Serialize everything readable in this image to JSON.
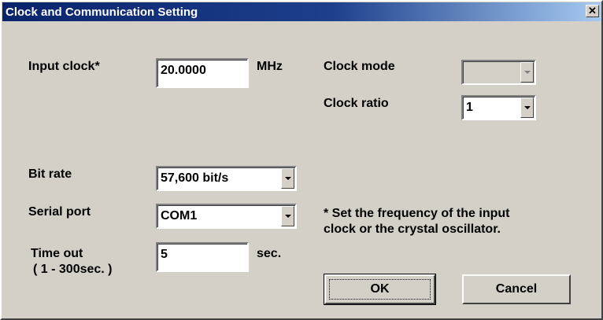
{
  "window": {
    "title": "Clock and Communication Setting",
    "close_label": "✕"
  },
  "input_clock": {
    "label": "Input clock*",
    "value": "20.0000",
    "unit": "MHz"
  },
  "clock_mode": {
    "label": "Clock mode",
    "value": ""
  },
  "clock_ratio": {
    "label": "Clock ratio",
    "value": "1"
  },
  "bit_rate": {
    "label": "Bit rate",
    "value": "57,600 bit/s"
  },
  "serial_port": {
    "label": "Serial port",
    "value": "COM1"
  },
  "time_out": {
    "label": "Time out",
    "range": "( 1 - 300sec. )",
    "value": "5",
    "unit": "sec."
  },
  "note": {
    "line1": "* Set the frequency of the input",
    "line2": "clock or the crystal oscillator."
  },
  "buttons": {
    "ok": "OK",
    "cancel": "Cancel"
  }
}
